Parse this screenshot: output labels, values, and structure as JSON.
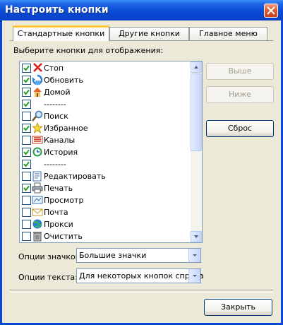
{
  "window": {
    "title": "Настроить кнопки"
  },
  "tabs": [
    {
      "label": "Стандартные кнопки",
      "active": true
    },
    {
      "label": "Другие кнопки",
      "active": false
    },
    {
      "label": "Главное меню",
      "active": false
    }
  ],
  "list": {
    "caption": "Выберите кнопки для отображения:",
    "items": [
      {
        "label": "Стоп",
        "checked": true,
        "icon": "stop-icon"
      },
      {
        "label": "Обновить",
        "checked": true,
        "icon": "refresh-icon"
      },
      {
        "label": "Домой",
        "checked": true,
        "icon": "home-icon"
      },
      {
        "label": "--------",
        "checked": true,
        "icon": ""
      },
      {
        "label": "Поиск",
        "checked": false,
        "icon": "search-icon"
      },
      {
        "label": "Избранное",
        "checked": true,
        "icon": "favorites-icon"
      },
      {
        "label": "Каналы",
        "checked": false,
        "icon": "channels-icon"
      },
      {
        "label": "История",
        "checked": true,
        "icon": "history-icon"
      },
      {
        "label": "--------",
        "checked": true,
        "icon": ""
      },
      {
        "label": "Редактировать",
        "checked": false,
        "icon": "edit-icon"
      },
      {
        "label": "Печать",
        "checked": true,
        "icon": "print-icon"
      },
      {
        "label": "Просмотр",
        "checked": false,
        "icon": "preview-icon"
      },
      {
        "label": "Почта",
        "checked": false,
        "icon": "mail-icon"
      },
      {
        "label": "Прокси",
        "checked": false,
        "icon": "proxy-icon"
      },
      {
        "label": "Очистить",
        "checked": false,
        "icon": "clear-icon"
      }
    ]
  },
  "buttons": {
    "up": "Выше",
    "down": "Ниже",
    "reset": "Сброс",
    "close": "Закрыть"
  },
  "options": {
    "icon_label": "Опции значков:",
    "icon_value": "Большие значки",
    "text_label": "Опции текста:",
    "text_value": "Для некоторых кнопок справа"
  }
}
